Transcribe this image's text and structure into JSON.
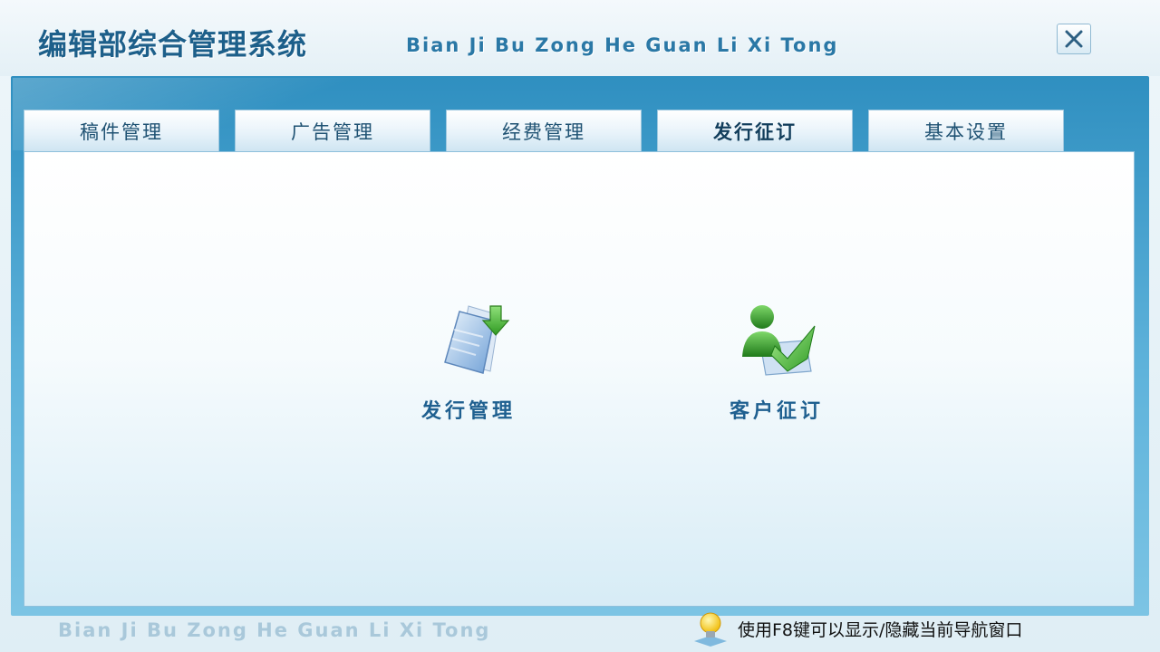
{
  "window": {
    "title_cn": "编辑部综合管理系统",
    "title_en": "Bian Ji Bu Zong He Guan Li Xi Tong",
    "close_label": "关闭"
  },
  "tabs": [
    {
      "label": "稿件管理",
      "active": false
    },
    {
      "label": "广告管理",
      "active": false
    },
    {
      "label": "经费管理",
      "active": false
    },
    {
      "label": "发行征订",
      "active": true
    },
    {
      "label": "基本设置",
      "active": false
    }
  ],
  "features": [
    {
      "label": "发行管理",
      "icon": "document-download-icon"
    },
    {
      "label": "客户征订",
      "icon": "customer-check-icon"
    }
  ],
  "footer": {
    "brand_en": "Bian Ji Bu Zong He Guan Li Xi Tong",
    "hint_text": "使用F8键可以显示/隐藏当前导航窗口",
    "hint_icon": "lightbulb-icon"
  },
  "colors": {
    "frame_blue": "#2f8fc0",
    "title_blue": "#1d5f8a",
    "label_blue": "#1f6090",
    "accent_green": "#3aa62a"
  }
}
